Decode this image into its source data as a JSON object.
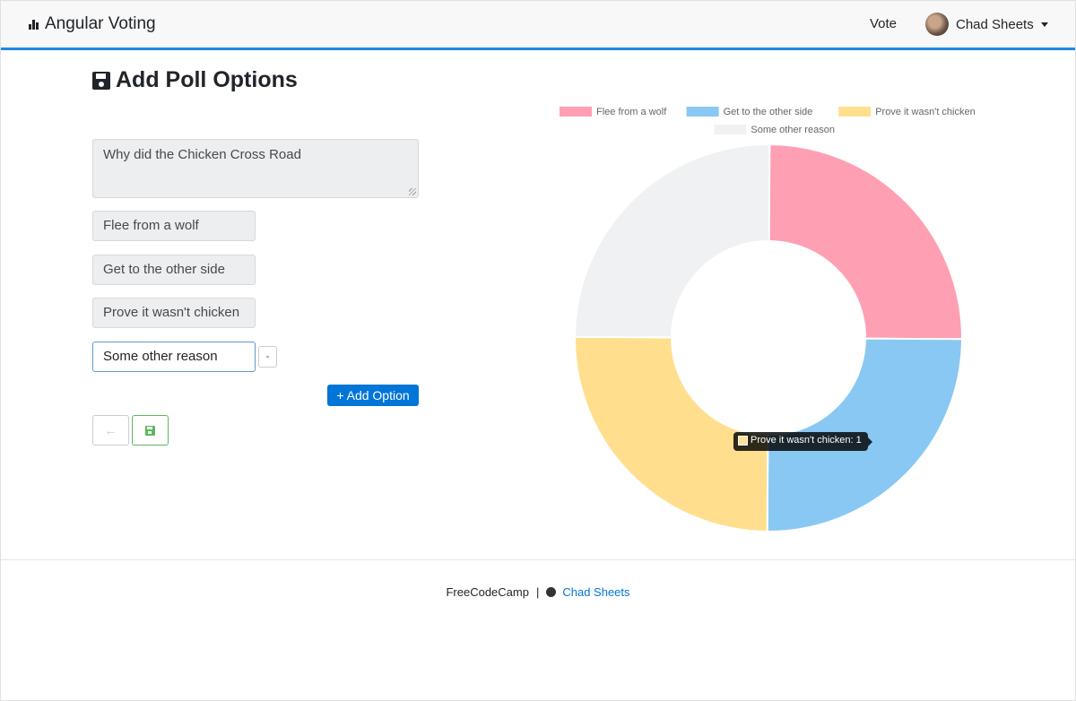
{
  "navbar": {
    "brand": "Angular Voting",
    "vote_link": "Vote",
    "user_name": "Chad Sheets"
  },
  "page": {
    "title": "Add Poll Options"
  },
  "form": {
    "question": "Why did the Chicken Cross Road",
    "options": [
      "Flee from a wolf",
      "Get to the other side",
      "Prove it wasn't chicken",
      "Some other reason"
    ],
    "remove_label": "-",
    "add_option_label": "+ Add Option",
    "back_label": "←"
  },
  "chart_data": {
    "type": "pie",
    "subtype": "doughnut",
    "categories": [
      "Flee from a wolf",
      "Get to the other side",
      "Prove it wasn't chicken",
      "Some other reason"
    ],
    "values": [
      1,
      1,
      1,
      1
    ],
    "colors": [
      "#ff9fb4",
      "#89c8f3",
      "#ffdf8e",
      "#f0f1f2"
    ],
    "legend_position": "top",
    "tooltip": "Prove it wasn't chicken: 1"
  },
  "footer": {
    "left_text": "FreeCodeCamp",
    "separator": "|",
    "author_link": "Chad Sheets"
  }
}
